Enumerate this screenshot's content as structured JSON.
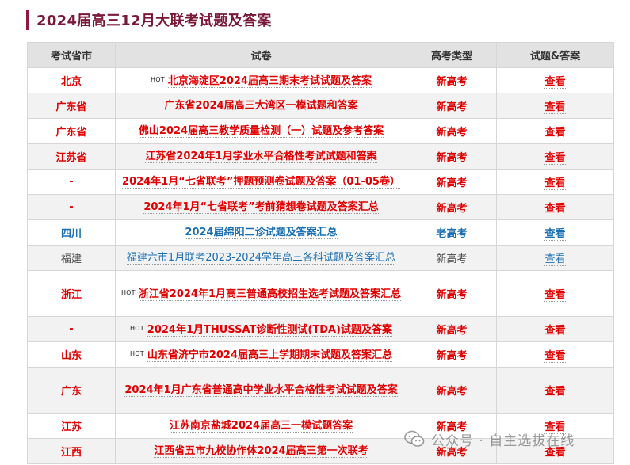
{
  "page_title": "2024届高三12月大联考试题及答案",
  "columns": [
    "考试省市",
    "试卷",
    "高考类型",
    "试题&答案"
  ],
  "hot_label": "HOT",
  "rows": [
    {
      "province": "北京",
      "paper": "北京海淀区2024届高三期末考试试题及答案",
      "type": "新高考",
      "action": "查看",
      "hot": true,
      "style": "red",
      "tall": false
    },
    {
      "province": "广东省",
      "paper": "广东省2024届高三大湾区一模试题和答案",
      "type": "新高考",
      "action": "查看",
      "hot": false,
      "style": "red",
      "tall": false
    },
    {
      "province": "广东省",
      "paper": "佛山2024届高三教学质量检测（一）试题及参考答案",
      "type": "新高考",
      "action": "查看",
      "hot": false,
      "style": "red",
      "tall": false
    },
    {
      "province": "江苏省",
      "paper": "江苏省2024年1月学业水平合格性考试试题和答案",
      "type": "新高考",
      "action": "查看",
      "hot": false,
      "style": "red",
      "tall": false
    },
    {
      "province": "-",
      "paper": "2024年1月“七省联考”押题预测卷试题及答案（01-05卷）",
      "type": "新高考",
      "action": "查看",
      "hot": false,
      "style": "red",
      "tall": false
    },
    {
      "province": "-",
      "paper": "2024年1月“七省联考”考前猜想卷试题及答案汇总",
      "type": "新高考",
      "action": "查看",
      "hot": false,
      "style": "red",
      "tall": false
    },
    {
      "province": "四川",
      "paper": "2024届绵阳二诊试题及答案汇总",
      "type": "老高考",
      "action": "查看",
      "hot": false,
      "style": "blue",
      "tall": false
    },
    {
      "province": "福建",
      "paper": "福建六市1月联考2023-2024学年高三各科试题及答案汇总",
      "type": "新高考",
      "action": "查看",
      "hot": false,
      "style": "plain",
      "tall": false
    },
    {
      "province": "浙江",
      "paper": "浙江省2024年1月高三普通高校招生选考试题及答案汇总",
      "type": "新高考",
      "action": "查看",
      "hot": true,
      "style": "red",
      "tall": true
    },
    {
      "province": "-",
      "paper": "2024年1月THUSSAT诊断性测试(TDA)试题及答案",
      "type": "新高考",
      "action": "查看",
      "hot": true,
      "style": "red",
      "tall": false
    },
    {
      "province": "山东",
      "paper": "山东省济宁市2024届高三上学期期末试题及答案汇总",
      "type": "新高考",
      "action": "查看",
      "hot": true,
      "style": "red",
      "tall": false
    },
    {
      "province": "广东",
      "paper": "2024年1月广东省普通高中学业水平合格性考试试题及答案",
      "type": "新高考",
      "action": "查看",
      "hot": false,
      "style": "red",
      "tall": true
    },
    {
      "province": "江苏",
      "paper": "江苏南京盐城2024届高三一模试题答案",
      "type": "新高考",
      "action": "查看",
      "hot": false,
      "style": "red",
      "tall": false
    },
    {
      "province": "江西",
      "paper": "江西省五市九校协作体2024届高三第一次联考",
      "type": "新高考",
      "action": "查看",
      "hot": false,
      "style": "red",
      "tall": false
    }
  ],
  "watermark": "公众号 · 自主选拔在线",
  "colors": {
    "accent": "#8b1a3d",
    "red": "#e00000",
    "blue": "#1a6fb3",
    "header_bg": "#e2e2e2"
  }
}
